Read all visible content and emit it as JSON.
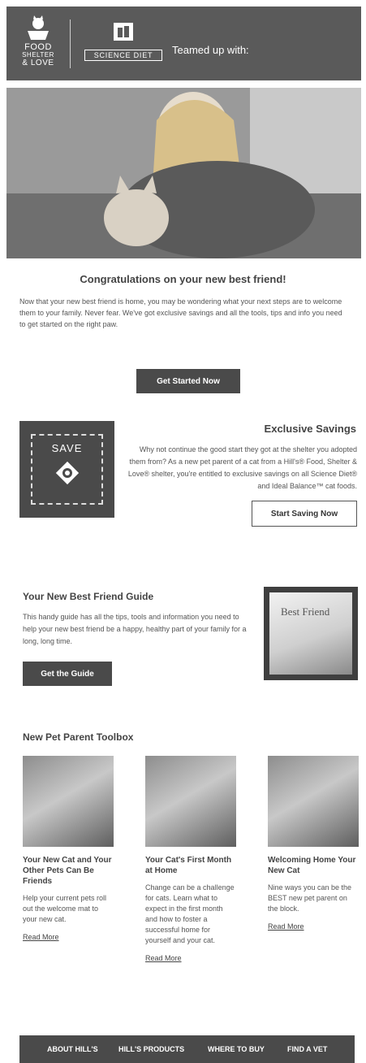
{
  "header": {
    "logo_food_shelter_love": {
      "line1": "FOOD",
      "line2": "SHELTER",
      "line3": "& LOVE"
    },
    "logo_science_diet": "SCIENCE DIET",
    "teamed_text": "Teamed up with:"
  },
  "hero": {
    "image_icon": "photo-woman-with-cat"
  },
  "intro": {
    "title": "Congratulations on your new best friend!",
    "body": "Now that your new best friend is home, you may be wondering what your next steps are to welcome them to your family. Never fear. We've got exclusive savings and all the tools, tips and info you need to get started on the right paw.",
    "cta": "Get Started Now"
  },
  "savings": {
    "badge_label": "SAVE",
    "title": "Exclusive Savings",
    "body": "Why not continue the good start they got at the shelter you adopted them from? As a new pet parent of a cat from a Hill's® Food, Shelter & Love® shelter, you're entitled to exclusive savings on all Science Diet® and Ideal Balance™ cat foods.",
    "cta": "Start Saving Now"
  },
  "guide": {
    "title": "Your New Best Friend Guide",
    "body": "This handy guide has all the tips, tools and information you need to help your new best friend be a happy, healthy part of your family for a long, long time.",
    "cta": "Get the Guide",
    "book_title": "Best Friend"
  },
  "toolbox": {
    "title": "New Pet Parent Toolbox",
    "items": [
      {
        "title": "Your New Cat and Your Other Pets Can Be Friends",
        "body": "Help your current pets roll out the welcome mat to your new cat.",
        "link": "Read More"
      },
      {
        "title": "Your Cat's First Month at Home",
        "body": "Change can be a challenge for cats. Learn what to expect in the first month and how to foster a successful home for yourself and your cat.",
        "link": "Read More"
      },
      {
        "title": "Welcoming Home Your New Cat",
        "body": "Nine ways you can be the BEST new pet parent on the block.",
        "link": "Read More"
      }
    ]
  },
  "footer": {
    "links": [
      "ABOUT HILL'S",
      "HILL'S PRODUCTS",
      "WHERE TO BUY",
      "FIND A VET"
    ]
  }
}
